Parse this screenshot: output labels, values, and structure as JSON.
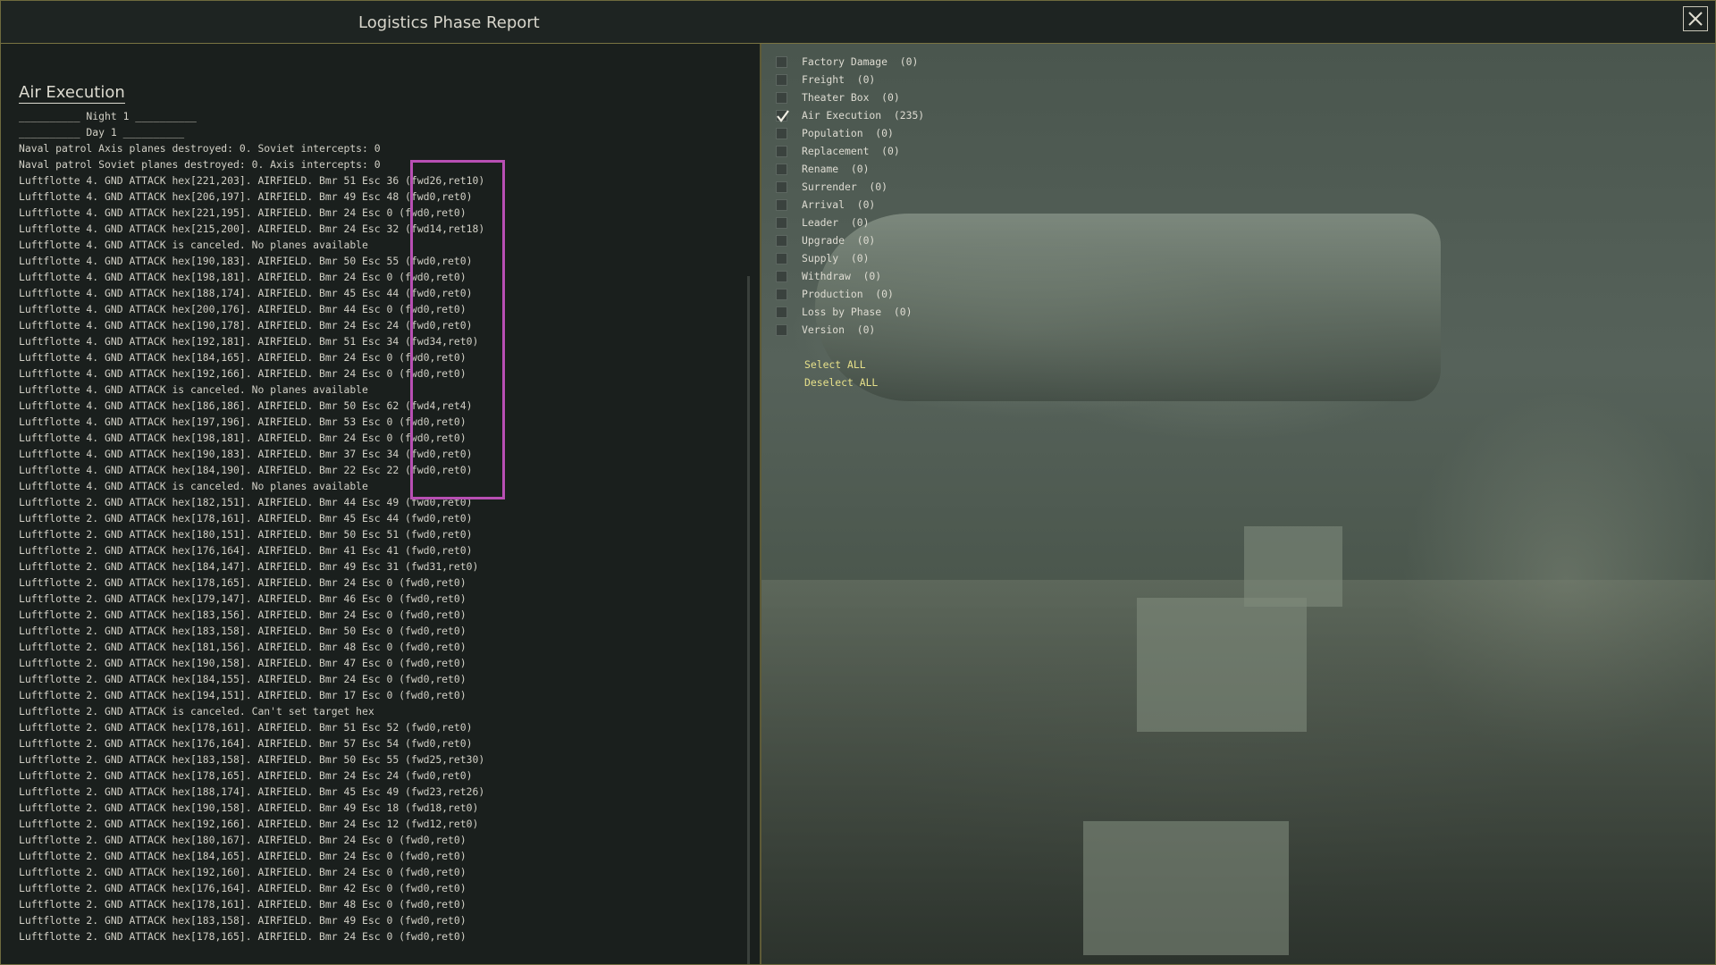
{
  "window": {
    "title": "Logistics Phase Report"
  },
  "section": {
    "heading": "Air Execution"
  },
  "log_lines": [
    "__________ Night 1 __________",
    "__________ Day 1 __________",
    "Naval patrol Axis planes destroyed: 0. Soviet intercepts: 0",
    "Naval patrol Soviet planes destroyed: 0. Axis intercepts: 0",
    "Luftflotte 4. GND ATTACK hex[221,203]. AIRFIELD. Bmr 51 Esc 36 (fwd26,ret10)",
    "Luftflotte 4. GND ATTACK hex[206,197]. AIRFIELD. Bmr 49 Esc 48 (fwd0,ret0)",
    "Luftflotte 4. GND ATTACK hex[221,195]. AIRFIELD. Bmr 24 Esc 0 (fwd0,ret0)",
    "Luftflotte 4. GND ATTACK hex[215,200]. AIRFIELD. Bmr 24 Esc 32 (fwd14,ret18)",
    "Luftflotte 4. GND ATTACK is canceled. No planes available",
    "Luftflotte 4. GND ATTACK hex[190,183]. AIRFIELD. Bmr 50 Esc 55 (fwd0,ret0)",
    "Luftflotte 4. GND ATTACK hex[198,181]. AIRFIELD. Bmr 24 Esc 0 (fwd0,ret0)",
    "Luftflotte 4. GND ATTACK hex[188,174]. AIRFIELD. Bmr 45 Esc 44 (fwd0,ret0)",
    "Luftflotte 4. GND ATTACK hex[200,176]. AIRFIELD. Bmr 44 Esc 0 (fwd0,ret0)",
    "Luftflotte 4. GND ATTACK hex[190,178]. AIRFIELD. Bmr 24 Esc 24 (fwd0,ret0)",
    "Luftflotte 4. GND ATTACK hex[192,181]. AIRFIELD. Bmr 51 Esc 34 (fwd34,ret0)",
    "Luftflotte 4. GND ATTACK hex[184,165]. AIRFIELD. Bmr 24 Esc 0 (fwd0,ret0)",
    "Luftflotte 4. GND ATTACK hex[192,166]. AIRFIELD. Bmr 24 Esc 0 (fwd0,ret0)",
    "Luftflotte 4. GND ATTACK is canceled. No planes available",
    "Luftflotte 4. GND ATTACK hex[186,186]. AIRFIELD. Bmr 50 Esc 62 (fwd4,ret4)",
    "Luftflotte 4. GND ATTACK hex[197,196]. AIRFIELD. Bmr 53 Esc 0 (fwd0,ret0)",
    "Luftflotte 4. GND ATTACK hex[198,181]. AIRFIELD. Bmr 24 Esc 0 (fwd0,ret0)",
    "Luftflotte 4. GND ATTACK hex[190,183]. AIRFIELD. Bmr 37 Esc 34 (fwd0,ret0)",
    "Luftflotte 4. GND ATTACK hex[184,190]. AIRFIELD. Bmr 22 Esc 22 (fwd0,ret0)",
    "Luftflotte 4. GND ATTACK is canceled. No planes available",
    "Luftflotte 2. GND ATTACK hex[182,151]. AIRFIELD. Bmr 44 Esc 49 (fwd0,ret0)",
    "Luftflotte 2. GND ATTACK hex[178,161]. AIRFIELD. Bmr 45 Esc 44 (fwd0,ret0)",
    "Luftflotte 2. GND ATTACK hex[180,151]. AIRFIELD. Bmr 50 Esc 51 (fwd0,ret0)",
    "Luftflotte 2. GND ATTACK hex[176,164]. AIRFIELD. Bmr 41 Esc 41 (fwd0,ret0)",
    "Luftflotte 2. GND ATTACK hex[184,147]. AIRFIELD. Bmr 49 Esc 31 (fwd31,ret0)",
    "Luftflotte 2. GND ATTACK hex[178,165]. AIRFIELD. Bmr 24 Esc 0 (fwd0,ret0)",
    "Luftflotte 2. GND ATTACK hex[179,147]. AIRFIELD. Bmr 46 Esc 0 (fwd0,ret0)",
    "Luftflotte 2. GND ATTACK hex[183,156]. AIRFIELD. Bmr 24 Esc 0 (fwd0,ret0)",
    "Luftflotte 2. GND ATTACK hex[183,158]. AIRFIELD. Bmr 50 Esc 0 (fwd0,ret0)",
    "Luftflotte 2. GND ATTACK hex[181,156]. AIRFIELD. Bmr 48 Esc 0 (fwd0,ret0)",
    "Luftflotte 2. GND ATTACK hex[190,158]. AIRFIELD. Bmr 47 Esc 0 (fwd0,ret0)",
    "Luftflotte 2. GND ATTACK hex[184,155]. AIRFIELD. Bmr 24 Esc 0 (fwd0,ret0)",
    "Luftflotte 2. GND ATTACK hex[194,151]. AIRFIELD. Bmr 17 Esc 0 (fwd0,ret0)",
    "Luftflotte 2. GND ATTACK is canceled. Can't set target hex",
    "Luftflotte 2. GND ATTACK hex[178,161]. AIRFIELD. Bmr 51 Esc 52 (fwd0,ret0)",
    "Luftflotte 2. GND ATTACK hex[176,164]. AIRFIELD. Bmr 57 Esc 54 (fwd0,ret0)",
    "Luftflotte 2. GND ATTACK hex[183,158]. AIRFIELD. Bmr 50 Esc 55 (fwd25,ret30)",
    "Luftflotte 2. GND ATTACK hex[178,165]. AIRFIELD. Bmr 24 Esc 24 (fwd0,ret0)",
    "Luftflotte 2. GND ATTACK hex[188,174]. AIRFIELD. Bmr 45 Esc 49 (fwd23,ret26)",
    "Luftflotte 2. GND ATTACK hex[190,158]. AIRFIELD. Bmr 49 Esc 18 (fwd18,ret0)",
    "Luftflotte 2. GND ATTACK hex[192,166]. AIRFIELD. Bmr 24 Esc 12 (fwd12,ret0)",
    "Luftflotte 2. GND ATTACK hex[180,167]. AIRFIELD. Bmr 24 Esc 0 (fwd0,ret0)",
    "Luftflotte 2. GND ATTACK hex[184,165]. AIRFIELD. Bmr 24 Esc 0 (fwd0,ret0)",
    "Luftflotte 2. GND ATTACK hex[192,160]. AIRFIELD. Bmr 24 Esc 0 (fwd0,ret0)",
    "Luftflotte 2. GND ATTACK hex[176,164]. AIRFIELD. Bmr 42 Esc 0 (fwd0,ret0)",
    "Luftflotte 2. GND ATTACK hex[178,161]. AIRFIELD. Bmr 48 Esc 0 (fwd0,ret0)",
    "Luftflotte 2. GND ATTACK hex[183,158]. AIRFIELD. Bmr 49 Esc 0 (fwd0,ret0)",
    "Luftflotte 2. GND ATTACK hex[178,165]. AIRFIELD. Bmr 24 Esc 0 (fwd0,ret0)"
  ],
  "filters": [
    {
      "label": "Factory Damage  (0)",
      "checked": false
    },
    {
      "label": "Freight  (0)",
      "checked": false
    },
    {
      "label": "Theater Box  (0)",
      "checked": false
    },
    {
      "label": "Air Execution  (235)",
      "checked": true
    },
    {
      "label": "Population  (0)",
      "checked": false
    },
    {
      "label": "Replacement  (0)",
      "checked": false
    },
    {
      "label": "Rename  (0)",
      "checked": false
    },
    {
      "label": "Surrender  (0)",
      "checked": false
    },
    {
      "label": "Arrival  (0)",
      "checked": false
    },
    {
      "label": "Leader  (0)",
      "checked": false
    },
    {
      "label": "Upgrade  (0)",
      "checked": false
    },
    {
      "label": "Supply  (0)",
      "checked": false
    },
    {
      "label": "Withdraw  (0)",
      "checked": false
    },
    {
      "label": "Production  (0)",
      "checked": false
    },
    {
      "label": "Loss by Phase  (0)",
      "checked": false
    },
    {
      "label": "Version  (0)",
      "checked": false
    }
  ],
  "actions": {
    "select_all": "Select ALL",
    "deselect_all": "Deselect ALL"
  },
  "colors": {
    "accent": "#e6e08a",
    "highlight": "#b84fb4",
    "border": "#7a7442"
  },
  "icons": {
    "close": "close-icon",
    "check": "checkmark-icon"
  }
}
